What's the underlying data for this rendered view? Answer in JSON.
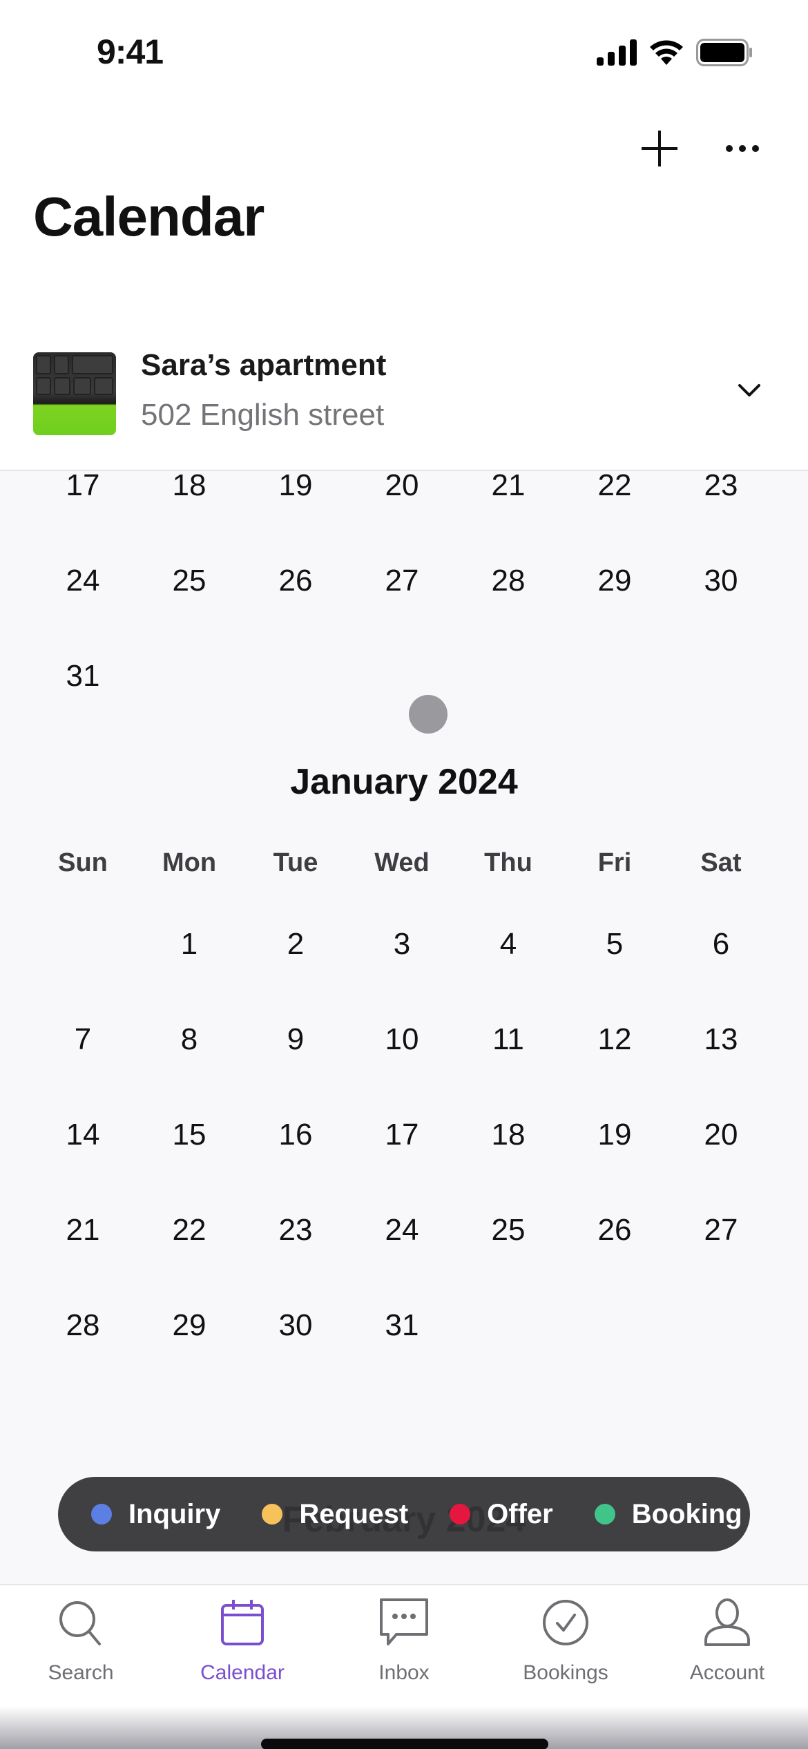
{
  "status_bar": {
    "time": "9:41"
  },
  "header": {
    "title": "Calendar",
    "add_icon": "plus-icon",
    "more_icon": "ellipsis-icon"
  },
  "listing": {
    "name": "Sara’s apartment",
    "address": "502 English street",
    "chevron_icon": "chevron-down-icon"
  },
  "calendar": {
    "prev_month_tail": {
      "rows": [
        [
          "17",
          "18",
          "19",
          "20",
          "21",
          "22",
          "23"
        ],
        [
          "24",
          "25",
          "26",
          "27",
          "28",
          "29",
          "30"
        ],
        [
          "31",
          "",
          "",
          "",
          "",
          "",
          ""
        ]
      ]
    },
    "months": [
      {
        "title": "January 2024",
        "weekdays": [
          "Sun",
          "Mon",
          "Tue",
          "Wed",
          "Thu",
          "Fri",
          "Sat"
        ],
        "rows": [
          [
            "",
            "1",
            "2",
            "3",
            "4",
            "5",
            "6"
          ],
          [
            "7",
            "8",
            "9",
            "10",
            "11",
            "12",
            "13"
          ],
          [
            "14",
            "15",
            "16",
            "17",
            "18",
            "19",
            "20"
          ],
          [
            "21",
            "22",
            "23",
            "24",
            "25",
            "26",
            "27"
          ],
          [
            "28",
            "29",
            "30",
            "31",
            "",
            "",
            ""
          ]
        ]
      },
      {
        "title": "February 2024"
      }
    ]
  },
  "legend": {
    "items": [
      {
        "label": "Inquiry",
        "color": "#5b7fe3"
      },
      {
        "label": "Request",
        "color": "#f7c25c"
      },
      {
        "label": "Offer",
        "color": "#e5173f"
      },
      {
        "label": "Booking",
        "color": "#40c48a"
      }
    ]
  },
  "tabbar": {
    "active_color": "#7a4fcf",
    "items": [
      {
        "label": "Search",
        "icon": "search-icon"
      },
      {
        "label": "Calendar",
        "icon": "calendar-icon",
        "active": true
      },
      {
        "label": "Inbox",
        "icon": "chat-icon"
      },
      {
        "label": "Bookings",
        "icon": "check-circle-icon"
      },
      {
        "label": "Account",
        "icon": "person-icon"
      }
    ]
  }
}
